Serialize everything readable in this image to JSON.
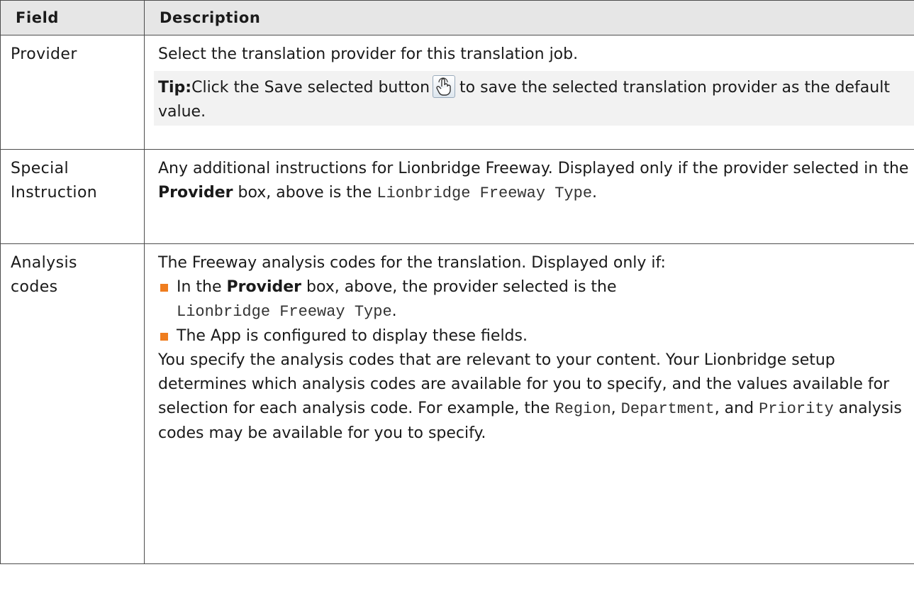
{
  "table": {
    "header": {
      "field": "Field",
      "description": "Description"
    },
    "rows": [
      {
        "field": "Provider",
        "desc_line": "Select the translation provider for this translation job.",
        "tip_label": "Tip:",
        "tip_text_before": "Click the Save selected button",
        "tip_text_after": "to save the selected translation provider as the default value.",
        "tip_icon": "hand-pointer-icon"
      },
      {
        "field_line1": "Special",
        "field_line2": "Instruction",
        "desc_part1": "Any additional instructions for Lionbridge Freeway. Displayed only if the provider selected in the",
        "desc_bold": "Provider",
        "desc_part2": "box, above is the",
        "desc_mono": "Lionbridge Freeway Type",
        "desc_end": "."
      },
      {
        "field_line1": "Analysis",
        "field_line2": "codes",
        "desc_intro": "The Freeway analysis codes for the translation. Displayed only if:",
        "bullet1_part1": "In the",
        "bullet1_bold": "Provider",
        "bullet1_part2": "box, above, the provider selected is the",
        "bullet1_mono": "Lionbridge Freeway Type",
        "bullet1_end": ".",
        "bullet2": "The App is configured to display these fields.",
        "para_part1": "You specify the analysis codes that are relevant to your content. Your Lionbridge setup determines which analysis codes are available for you to specify, and the values available for selection for each analysis code. For example, the",
        "para_mono1": "Region",
        "para_sep1": ",",
        "para_mono2": "Department",
        "para_sep2": ", and",
        "para_mono3": "Priority",
        "para_end": "analysis codes may be available for you to specify."
      }
    ]
  },
  "colors": {
    "header_bg": "#e6e6e6",
    "tip_bg": "#f2f2f2",
    "bullet": "#ef7d1f",
    "border": "#4d4d4d"
  }
}
